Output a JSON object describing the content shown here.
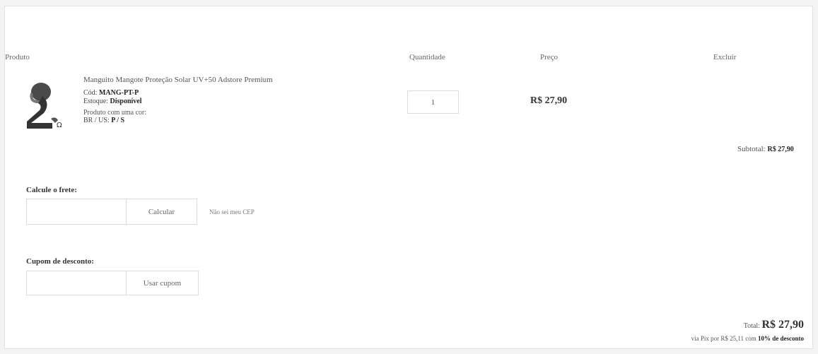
{
  "columns": {
    "product": "Produto",
    "quantity": "Quantidade",
    "price": "Preço",
    "remove": "Excluir"
  },
  "cart_item": {
    "name": "Manguito Mangote Proteção Solar UV+50 Adstore Premium",
    "code_label": "Cód: ",
    "code": "MANG-PT-P",
    "stock_label": "Estoque: ",
    "stock": "Disponível",
    "variant_label": "Produto com uma cor:",
    "size_label": "BR / US: ",
    "size": "P / S",
    "quantity": "1",
    "price": "R$ 27,90",
    "image_color": "#3d3d3d"
  },
  "subtotal": {
    "label": "Subtotal: ",
    "value": "R$ 27,90"
  },
  "shipping": {
    "label": "Calcule o frete:",
    "input_value": "",
    "button": "Calcular",
    "no_cep_link": "Não sei meu CEP"
  },
  "coupon": {
    "label": "Cupom de desconto:",
    "input_value": "",
    "button": "Usar cupom"
  },
  "total": {
    "label": "Total: ",
    "value": "R$ 27,90",
    "pix_prefix": "via Pix por R$ 25,11 com ",
    "pix_discount": "10% de desconto"
  }
}
